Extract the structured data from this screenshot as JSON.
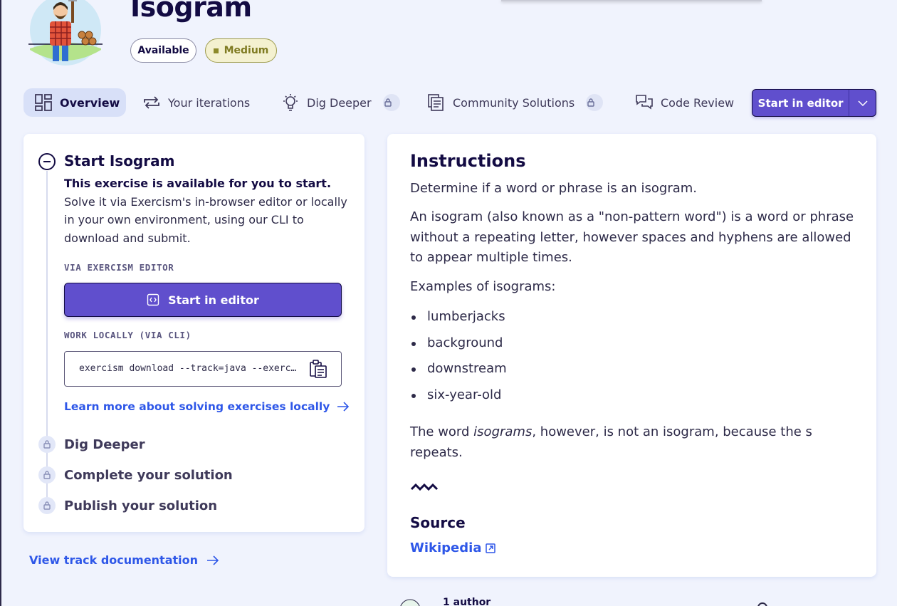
{
  "exercise": {
    "title": "Isogram",
    "status_pill": "Available",
    "difficulty_pill": "Medium"
  },
  "tabs": [
    {
      "label": "Overview",
      "icon": "overview-icon",
      "active": true
    },
    {
      "label": "Your iterations",
      "icon": "iterations-icon"
    },
    {
      "label": "Dig Deeper",
      "icon": "bulb-icon",
      "locked": true
    },
    {
      "label": "Community Solutions",
      "icon": "community-icon",
      "locked": true
    },
    {
      "label": "Code Review",
      "icon": "chat-icon"
    }
  ],
  "start_editor_split": {
    "label": "Start in editor"
  },
  "left_panel": {
    "step_title": "Start Isogram",
    "desc_bold": "This exercise is available for you to start.",
    "desc_rest": " Solve it via Exercism's in-browser editor or locally in your own environment, using our CLI to download and submit.",
    "via_editor_label": "VIA EXERCISM EDITOR",
    "editor_button": "Start in editor",
    "work_locally_label": "WORK LOCALLY (VIA CLI)",
    "cli_command": "exercism download --track=java --exercise=isogram",
    "learn_more": "Learn more about solving exercises locally",
    "locked_steps": [
      "Dig Deeper",
      "Complete your solution",
      "Publish your solution"
    ]
  },
  "track_doc_link": "View track documentation",
  "instructions": {
    "title": "Instructions",
    "p1": "Determine if a word or phrase is an isogram.",
    "p2": "An isogram (also known as a \"non-pattern word\") is a word or phrase without a repeating letter, however spaces and hyphens are allowed to appear multiple times.",
    "p3": "Examples of isograms:",
    "examples": [
      "lumberjacks",
      "background",
      "downstream",
      "six-year-old"
    ],
    "p4_before": "The word ",
    "p4_em": "isograms",
    "p4_after": ", however, is not an isogram, because the s repeats.",
    "source_title": "Source",
    "source_link": "Wikipedia"
  },
  "authors_peek": "1 author",
  "colors": {
    "accent": "#604fcd",
    "link": "#2e57e8",
    "text": "#130b43",
    "background": "#f0f3fd"
  }
}
